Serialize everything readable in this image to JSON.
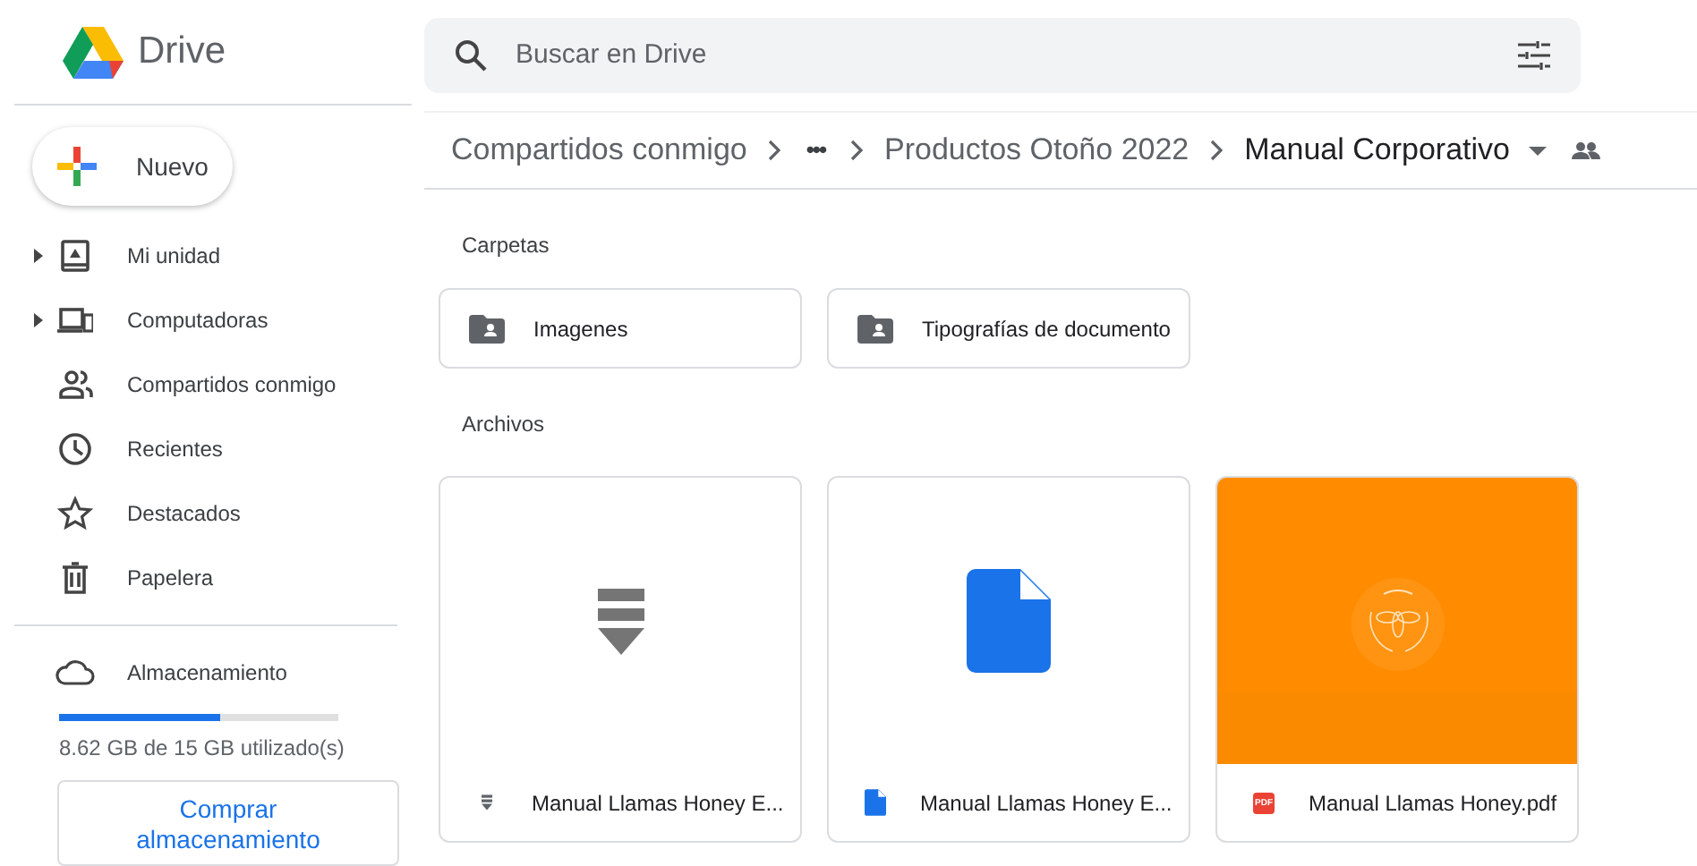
{
  "app": {
    "name": "Drive"
  },
  "search": {
    "placeholder": "Buscar en Drive"
  },
  "new_button": {
    "label": "Nuevo"
  },
  "sidebar": {
    "items": [
      {
        "label": "Mi unidad",
        "kind": "drive",
        "expandable": true
      },
      {
        "label": "Computadoras",
        "kind": "computers",
        "expandable": true
      },
      {
        "label": "Compartidos conmigo",
        "kind": "shared",
        "expandable": false
      },
      {
        "label": "Recientes",
        "kind": "recent",
        "expandable": false
      },
      {
        "label": "Destacados",
        "kind": "starred",
        "expandable": false
      },
      {
        "label": "Papelera",
        "kind": "trash",
        "expandable": false
      }
    ]
  },
  "storage": {
    "label": "Almacenamiento",
    "level": 0.575,
    "usage": "8.62 GB de 15 GB utilizado(s)",
    "button": "Comprar almacenamiento"
  },
  "breadcrumb": [
    {
      "label": "Compartidos conmigo",
      "kind": "link"
    },
    {
      "label": "•••",
      "kind": "more"
    },
    {
      "label": "Productos Otoño 2022",
      "kind": "link"
    },
    {
      "label": "Manual Corporativo",
      "kind": "current"
    }
  ],
  "sections": {
    "folders": "Carpetas",
    "files": "Archivos"
  },
  "folders": [
    {
      "name": "Imagenes"
    },
    {
      "name": "Tipografías de documento"
    }
  ],
  "files": [
    {
      "name": "Manual Llamas Honey E...",
      "kind": "text"
    },
    {
      "name": "Manual Llamas Honey E...",
      "kind": "doc"
    },
    {
      "name": "Manual Llamas Honey.pdf",
      "kind": "pdf",
      "badge": "PDF"
    }
  ]
}
